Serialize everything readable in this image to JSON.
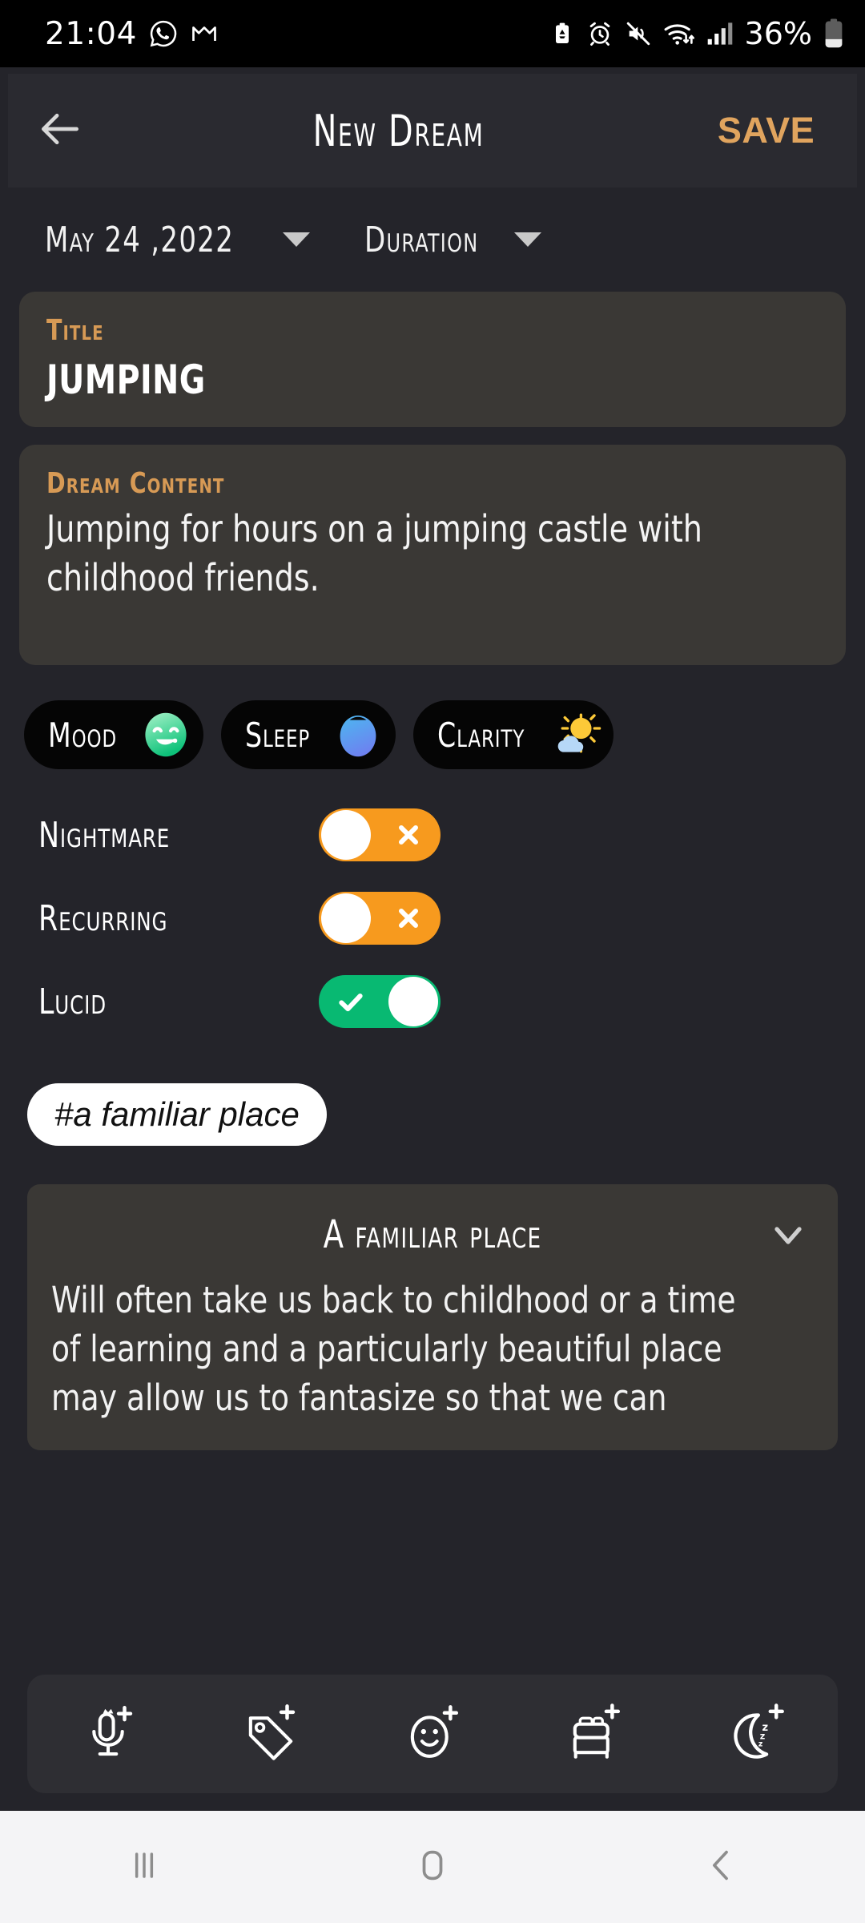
{
  "status_bar": {
    "time": "21:04",
    "left_icons": [
      "whatsapp-icon",
      "gmail-icon"
    ],
    "right_icons": [
      "battery-saver-icon",
      "alarm-icon",
      "mute-icon",
      "wifi-icon",
      "signal-icon"
    ],
    "battery_percent": "36%"
  },
  "app_bar": {
    "back_icon": "back-arrow-icon",
    "title": "New Dream",
    "save_label": "SAVE",
    "save_color": "#e0a45e"
  },
  "meta": {
    "date_value": "May 24 ,2022",
    "duration_label": "Duration"
  },
  "title_card": {
    "label": "Title",
    "value": "JUMPING"
  },
  "content_card": {
    "label": "Dream Content",
    "value": "Jumping for hours on a jumping castle with childhood friends."
  },
  "chips": [
    {
      "label": "Mood",
      "icon": "smiley-face-icon",
      "name": "chip-mood"
    },
    {
      "label": "Sleep",
      "icon": "sleep-drop-icon",
      "name": "chip-sleep"
    },
    {
      "label": "Clarity",
      "icon": "sun-behind-cloud-icon",
      "name": "chip-clarity"
    }
  ],
  "toggles": [
    {
      "label": "Nightmare",
      "state": "off",
      "glyph": "cross-icon",
      "color": "#f79a1e"
    },
    {
      "label": "Recurring",
      "state": "off",
      "glyph": "cross-icon",
      "color": "#f79a1e"
    },
    {
      "label": "Lucid",
      "state": "on",
      "glyph": "check-icon",
      "color": "#08b972"
    }
  ],
  "tags": [
    {
      "label": "#a familiar place"
    }
  ],
  "info_card": {
    "title": "A familiar place",
    "chevron_icon": "chevron-down-icon",
    "body": "Will often take us back to childhood or a time of learning and a particularly beautiful place may allow us to fantasize so that we can"
  },
  "toolbar": [
    {
      "icon": "microphone-add-icon",
      "name": "toolbar-add-voice"
    },
    {
      "icon": "tag-add-icon",
      "name": "toolbar-add-tag"
    },
    {
      "icon": "emoji-add-icon",
      "name": "toolbar-add-mood"
    },
    {
      "icon": "bed-add-icon",
      "name": "toolbar-add-sleep"
    },
    {
      "icon": "moon-zzz-add-icon",
      "name": "toolbar-add-clarity"
    }
  ],
  "nav_bar": {
    "recents_icon": "recents-icon",
    "home_icon": "home-icon",
    "back_icon": "nav-back-icon"
  },
  "colors": {
    "page_bg": "#24242a",
    "card_bg": "#3a3835",
    "appbar_bg": "#2a2a30",
    "accent": "#d79a55",
    "toggle_off": "#f79a1e",
    "toggle_on": "#08b972"
  }
}
